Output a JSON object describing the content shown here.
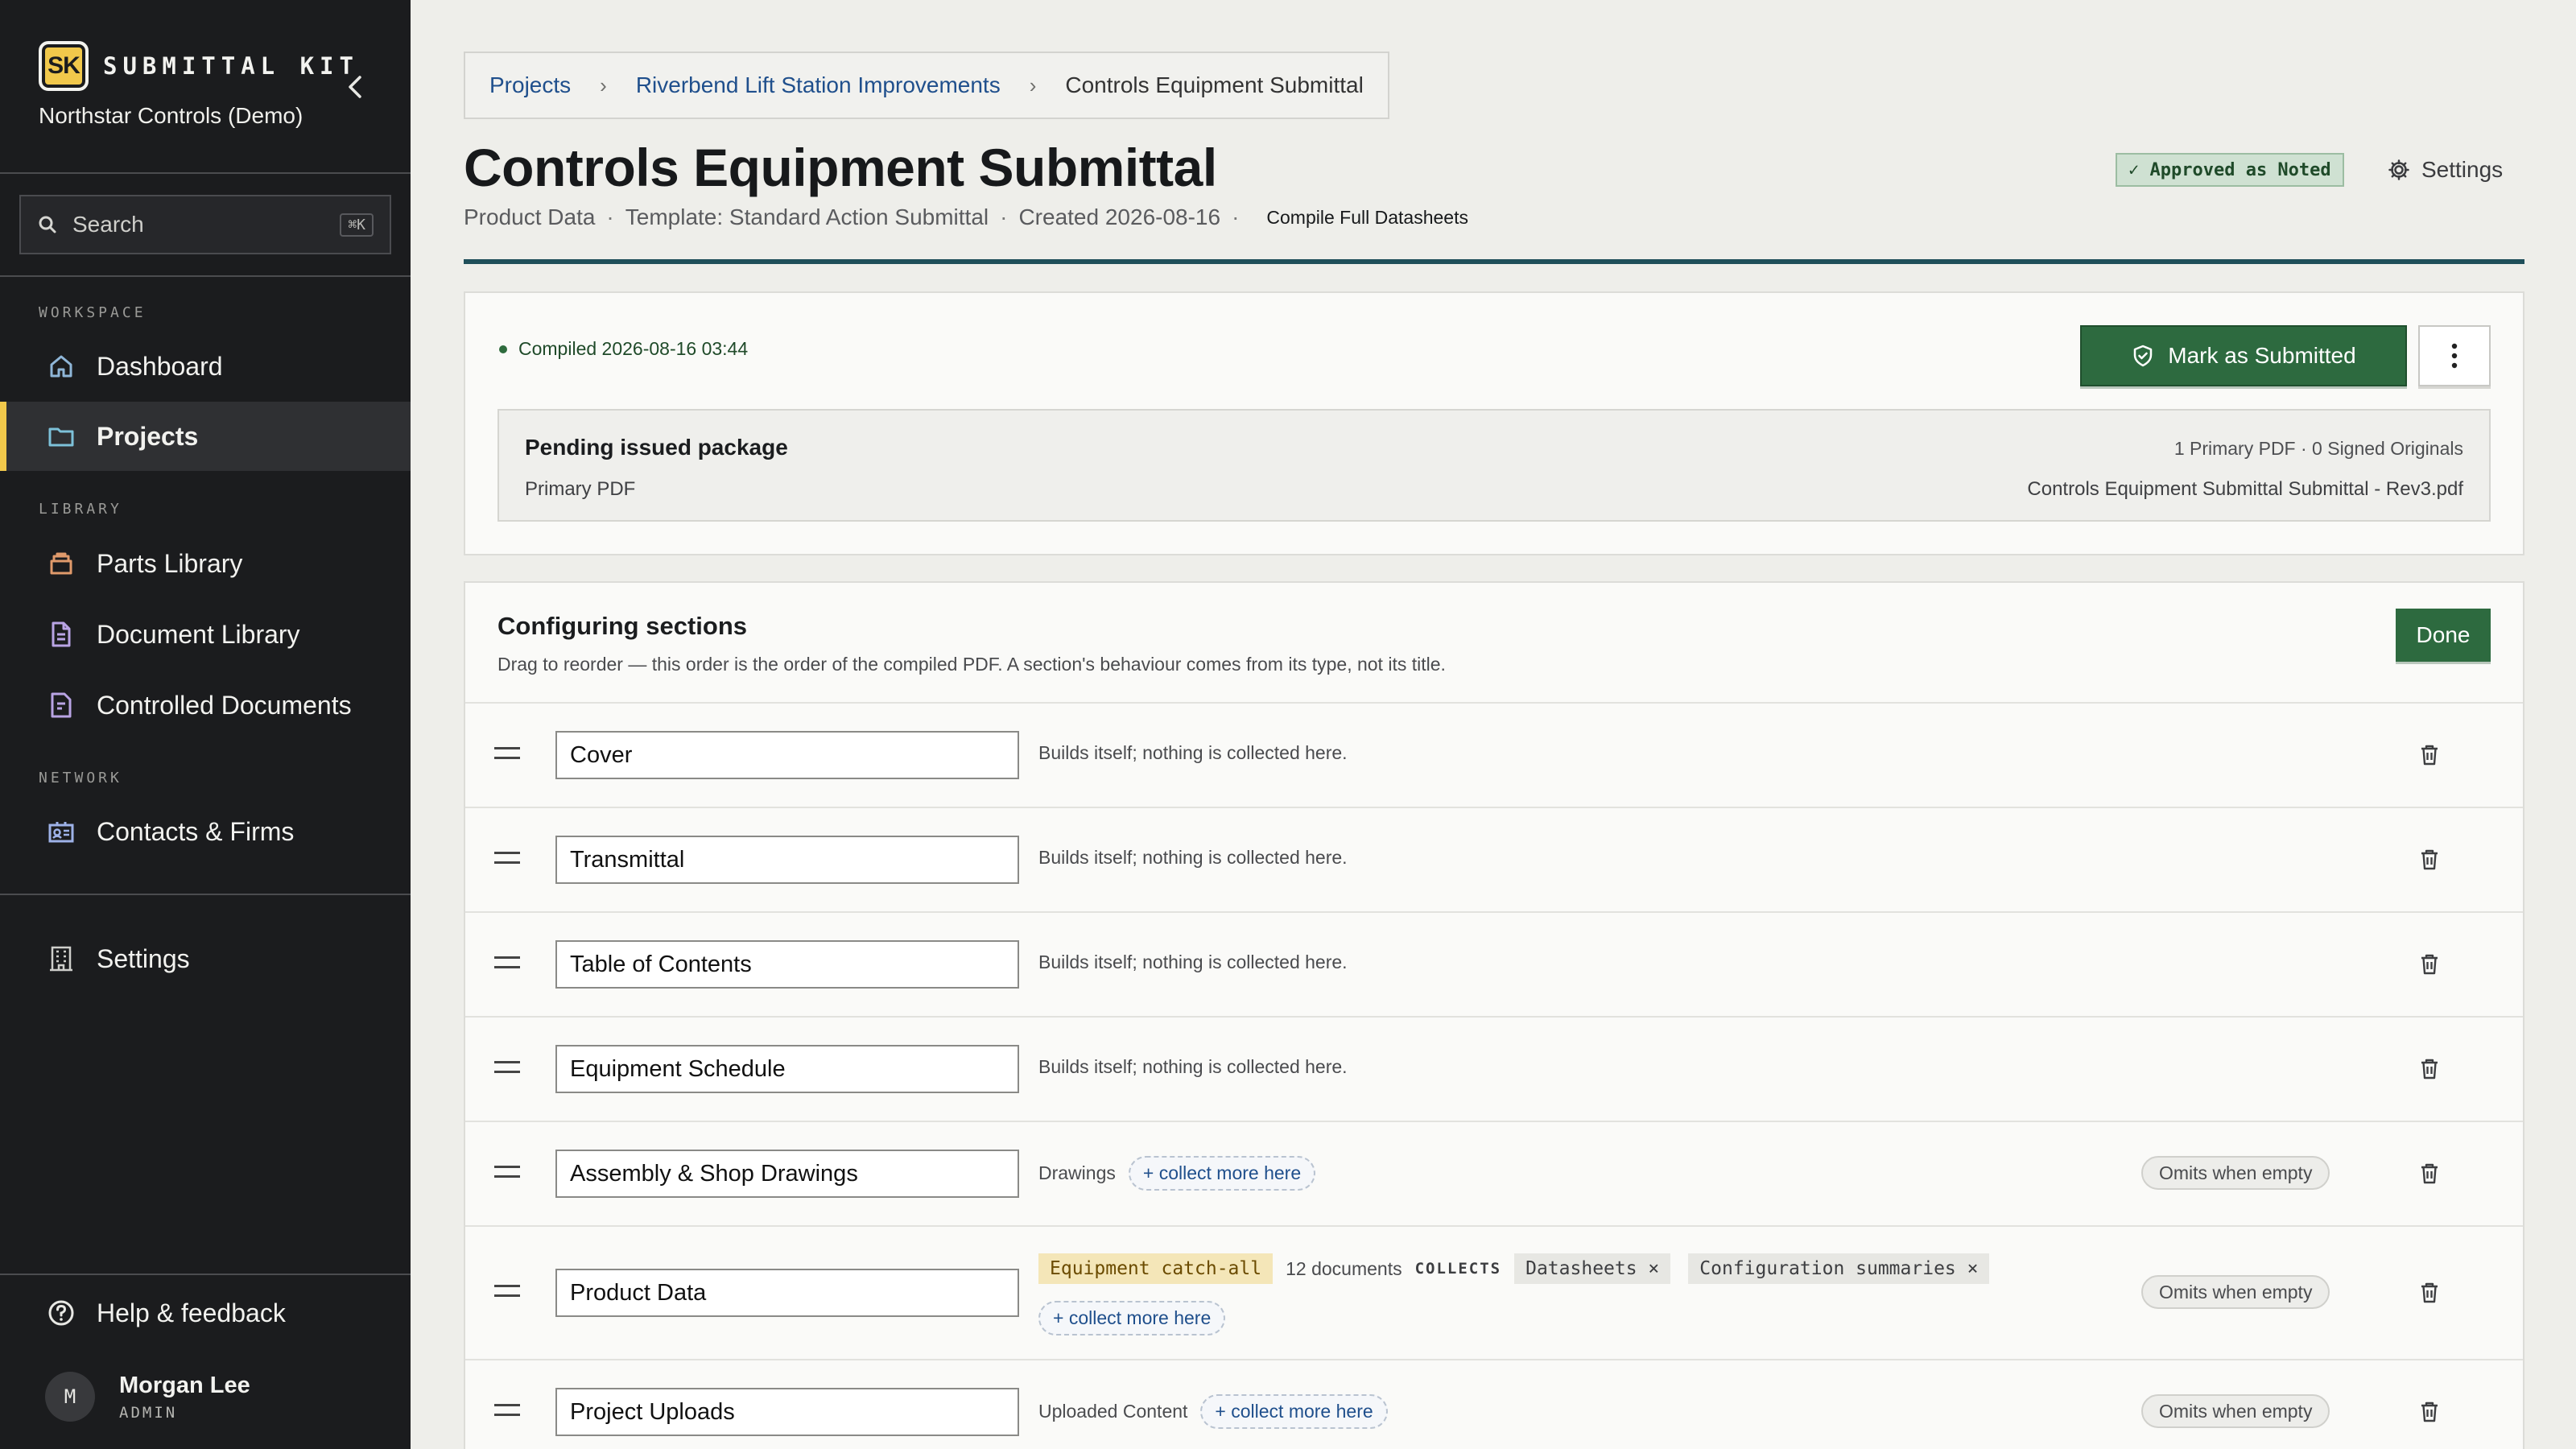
{
  "app": {
    "logo_text": "SK",
    "brand": "SUBMITTAL KIT",
    "org": "Northstar Controls (Demo)"
  },
  "search": {
    "label": "Search",
    "shortcut": "⌘K"
  },
  "sidebar": {
    "sections": {
      "workspace": "WORKSPACE",
      "library": "LIBRARY",
      "network": "NETWORK"
    },
    "items": [
      {
        "label": "Dashboard",
        "icon": "home-icon"
      },
      {
        "label": "Projects",
        "icon": "folder-icon",
        "active": true
      },
      {
        "label": "Parts Library",
        "icon": "box-icon"
      },
      {
        "label": "Document Library",
        "icon": "document-icon"
      },
      {
        "label": "Controlled Documents",
        "icon": "controlled-document-icon"
      },
      {
        "label": "Contacts & Firms",
        "icon": "contact-card-icon"
      },
      {
        "label": "Settings",
        "icon": "building-icon"
      },
      {
        "label": "Help & feedback",
        "icon": "help-icon"
      }
    ]
  },
  "user": {
    "initial": "M",
    "name": "Morgan Lee",
    "role": "ADMIN"
  },
  "breadcrumb": [
    "Projects",
    "Riverbend Lift Station Improvements",
    "Controls Equipment Submittal"
  ],
  "page": {
    "title": "Controls Equipment Submittal",
    "meta": [
      "Product Data",
      "Template: Standard Action Submittal",
      "Created 2026-08-16"
    ],
    "compile_link": "Compile Full Datasheets",
    "status_badge": "✓ Approved as Noted",
    "settings_label": "Settings"
  },
  "compile_card": {
    "status": "Compiled 2026-08-16 03:44",
    "primary_action": "Mark as Submitted",
    "pending": {
      "title": "Pending issued package",
      "subtitle": "Primary PDF",
      "counts": "1 Primary PDF · 0 Signed Originals",
      "filename": "Controls Equipment Submittal Submittal - Rev3.pdf"
    }
  },
  "config": {
    "title": "Configuring sections",
    "description": "Drag to reorder — this order is the order of the compiled PDF. A section's behaviour comes from its type, not its title.",
    "done_label": "Done",
    "sections": [
      {
        "name": "Cover",
        "note": "Builds itself; nothing is collected here."
      },
      {
        "name": "Transmittal",
        "note": "Builds itself; nothing is collected here."
      },
      {
        "name": "Table of Contents",
        "note": "Builds itself; nothing is collected here."
      },
      {
        "name": "Equipment Schedule",
        "note": "Builds itself; nothing is collected here."
      },
      {
        "name": "Assembly & Shop Drawings",
        "note": "Drawings",
        "collect": "+ collect more here",
        "omit": "Omits when empty"
      },
      {
        "name": "Product Data",
        "tag": "Equipment catch-all",
        "count": "12 documents",
        "collects_label": "COLLECTS",
        "chips": [
          "Datasheets ×",
          "Configuration summaries ×"
        ],
        "collect": "+ collect more here",
        "omit": "Omits when empty"
      },
      {
        "name": "Project Uploads",
        "note": "Uploaded Content",
        "collect": "+ collect more here",
        "omit": "Omits when empty"
      }
    ]
  },
  "colors": {
    "sidebar_bg": "#1b1c1e",
    "accent_yellow": "#f1c84b",
    "primary_green": "#2d6a3f",
    "link_blue": "#1f4f8c"
  }
}
